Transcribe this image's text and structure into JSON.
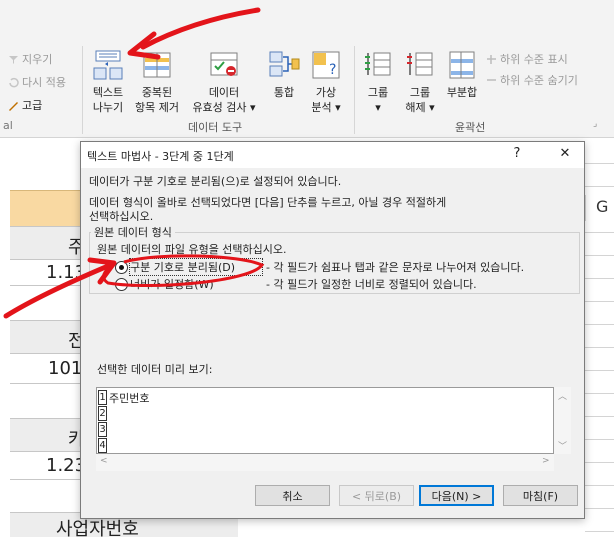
{
  "ribbon": {
    "sort_filter_items": {
      "clear": "지우기",
      "reapply": "다시 적용",
      "advanced": "고급"
    },
    "buttons": {
      "text_to_columns": [
        "텍스트",
        "나누기"
      ],
      "remove_duplicates": [
        "중복된",
        "항목 제거"
      ],
      "data_validation": [
        "데이터",
        "유효성 검사 ▾"
      ],
      "consolidate": [
        "통합",
        ""
      ],
      "what_if": [
        "가상",
        "분석 ▾"
      ],
      "group": [
        "그룹",
        "▾"
      ],
      "ungroup": [
        "그룹",
        "해제 ▾"
      ],
      "subtotal": [
        "부분합",
        ""
      ]
    },
    "outline_small": {
      "show_detail": "하위 수준 표시",
      "hide_detail": "하위 수준 숨기기"
    },
    "groups": {
      "data_tools": "데이터 도구",
      "outline": "윤곽선"
    }
  },
  "sheet": {
    "column_g": "G",
    "cells": {
      "c1": "주",
      "c2": "1.13",
      "c3": "전",
      "c4": "101",
      "c5": "카",
      "c6": "1.23",
      "c7": "사업자번호"
    }
  },
  "dialog": {
    "title": "텍스트 마법사 - 3단계 중 1단계",
    "help_btn": "?",
    "close_btn": "✕",
    "line1": "데이터가 구분 기호로 분리됨(으)로 설정되어 있습니다.",
    "line2": "데이터 형식이 올바로 선택되었다면 [다음] 단추를 누르고, 아닐 경우 적절하게",
    "line3": "선택하십시오.",
    "group_title": "원본 데이터 형식",
    "group_prompt": "원본 데이터의 파일 유형을 선택하십시오.",
    "radio_delimited": "구분 기호로 분리됨(D)",
    "radio_delimited_desc": "- 각 필드가 쉼표나 탭과 같은 문자로 나누어져 있습니다.",
    "radio_fixed": "너비가 일정함(W)",
    "radio_fixed_desc": "- 각 필드가 일정한 너비로 정렬되어 있습니다.",
    "preview_label": "선택한 데이터 미리 보기:",
    "preview_rows": [
      {
        "num": "1",
        "text": "주민번호"
      },
      {
        "num": "2",
        "text": ""
      },
      {
        "num": "3",
        "text": ""
      },
      {
        "num": "4",
        "text": ""
      }
    ],
    "buttons": {
      "cancel": "취소",
      "back": "< 뒤로(B)",
      "next": "다음(N) >",
      "finish": "마침(F)"
    }
  },
  "colors": {
    "annotation": "#e3141a",
    "header_fill": "#f9d9a2",
    "cell_fill": "#ededed"
  }
}
